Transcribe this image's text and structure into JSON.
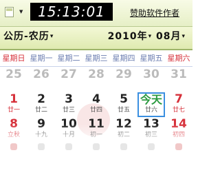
{
  "topbar": {
    "menu_icon": "calendar-menu-icon",
    "dropdown_icon": "chevron-down-icon",
    "clock_time": "15:13:01",
    "sponsor_label": "赞助软件作者"
  },
  "header": {
    "calendar_mode": "公历-农历",
    "year": "2010年",
    "month": "08月",
    "caret": "▾"
  },
  "weekdays": [
    "星期日",
    "星期一",
    "星期二",
    "星期三",
    "星期四",
    "星期五",
    "星期六"
  ],
  "rows": [
    [
      {
        "day": "25",
        "lunar": "",
        "type": "prev"
      },
      {
        "day": "26",
        "lunar": "",
        "type": "prev"
      },
      {
        "day": "27",
        "lunar": "",
        "type": "prev"
      },
      {
        "day": "28",
        "lunar": "",
        "type": "prev"
      },
      {
        "day": "29",
        "lunar": "",
        "type": "prev"
      },
      {
        "day": "30",
        "lunar": "",
        "type": "prev"
      },
      {
        "day": "31",
        "lunar": "",
        "type": "prev"
      }
    ],
    [
      {
        "day": "1",
        "lunar": "廿一",
        "type": "holiday"
      },
      {
        "day": "2",
        "lunar": "廿二",
        "type": ""
      },
      {
        "day": "3",
        "lunar": "廿三",
        "type": ""
      },
      {
        "day": "4",
        "lunar": "廿四",
        "type": ""
      },
      {
        "day": "5",
        "lunar": "廿五",
        "type": ""
      },
      {
        "day": "今天",
        "lunar": "廿六",
        "type": "today"
      },
      {
        "day": "7",
        "lunar": "廿七",
        "type": "holiday"
      }
    ],
    [
      {
        "day": "8",
        "lunar": "立秋",
        "type": "holiday"
      },
      {
        "day": "9",
        "lunar": "十九",
        "type": ""
      },
      {
        "day": "10",
        "lunar": "十月",
        "type": ""
      },
      {
        "day": "11",
        "lunar": "初一",
        "type": ""
      },
      {
        "day": "12",
        "lunar": "初二",
        "type": ""
      },
      {
        "day": "13",
        "lunar": "初三",
        "type": ""
      },
      {
        "day": "14",
        "lunar": "初四",
        "type": "holiday"
      }
    ]
  ],
  "colors": {
    "accent_green": "#9db46a",
    "weekend_red": "#d6303a",
    "today_border": "#3a8fe0"
  }
}
